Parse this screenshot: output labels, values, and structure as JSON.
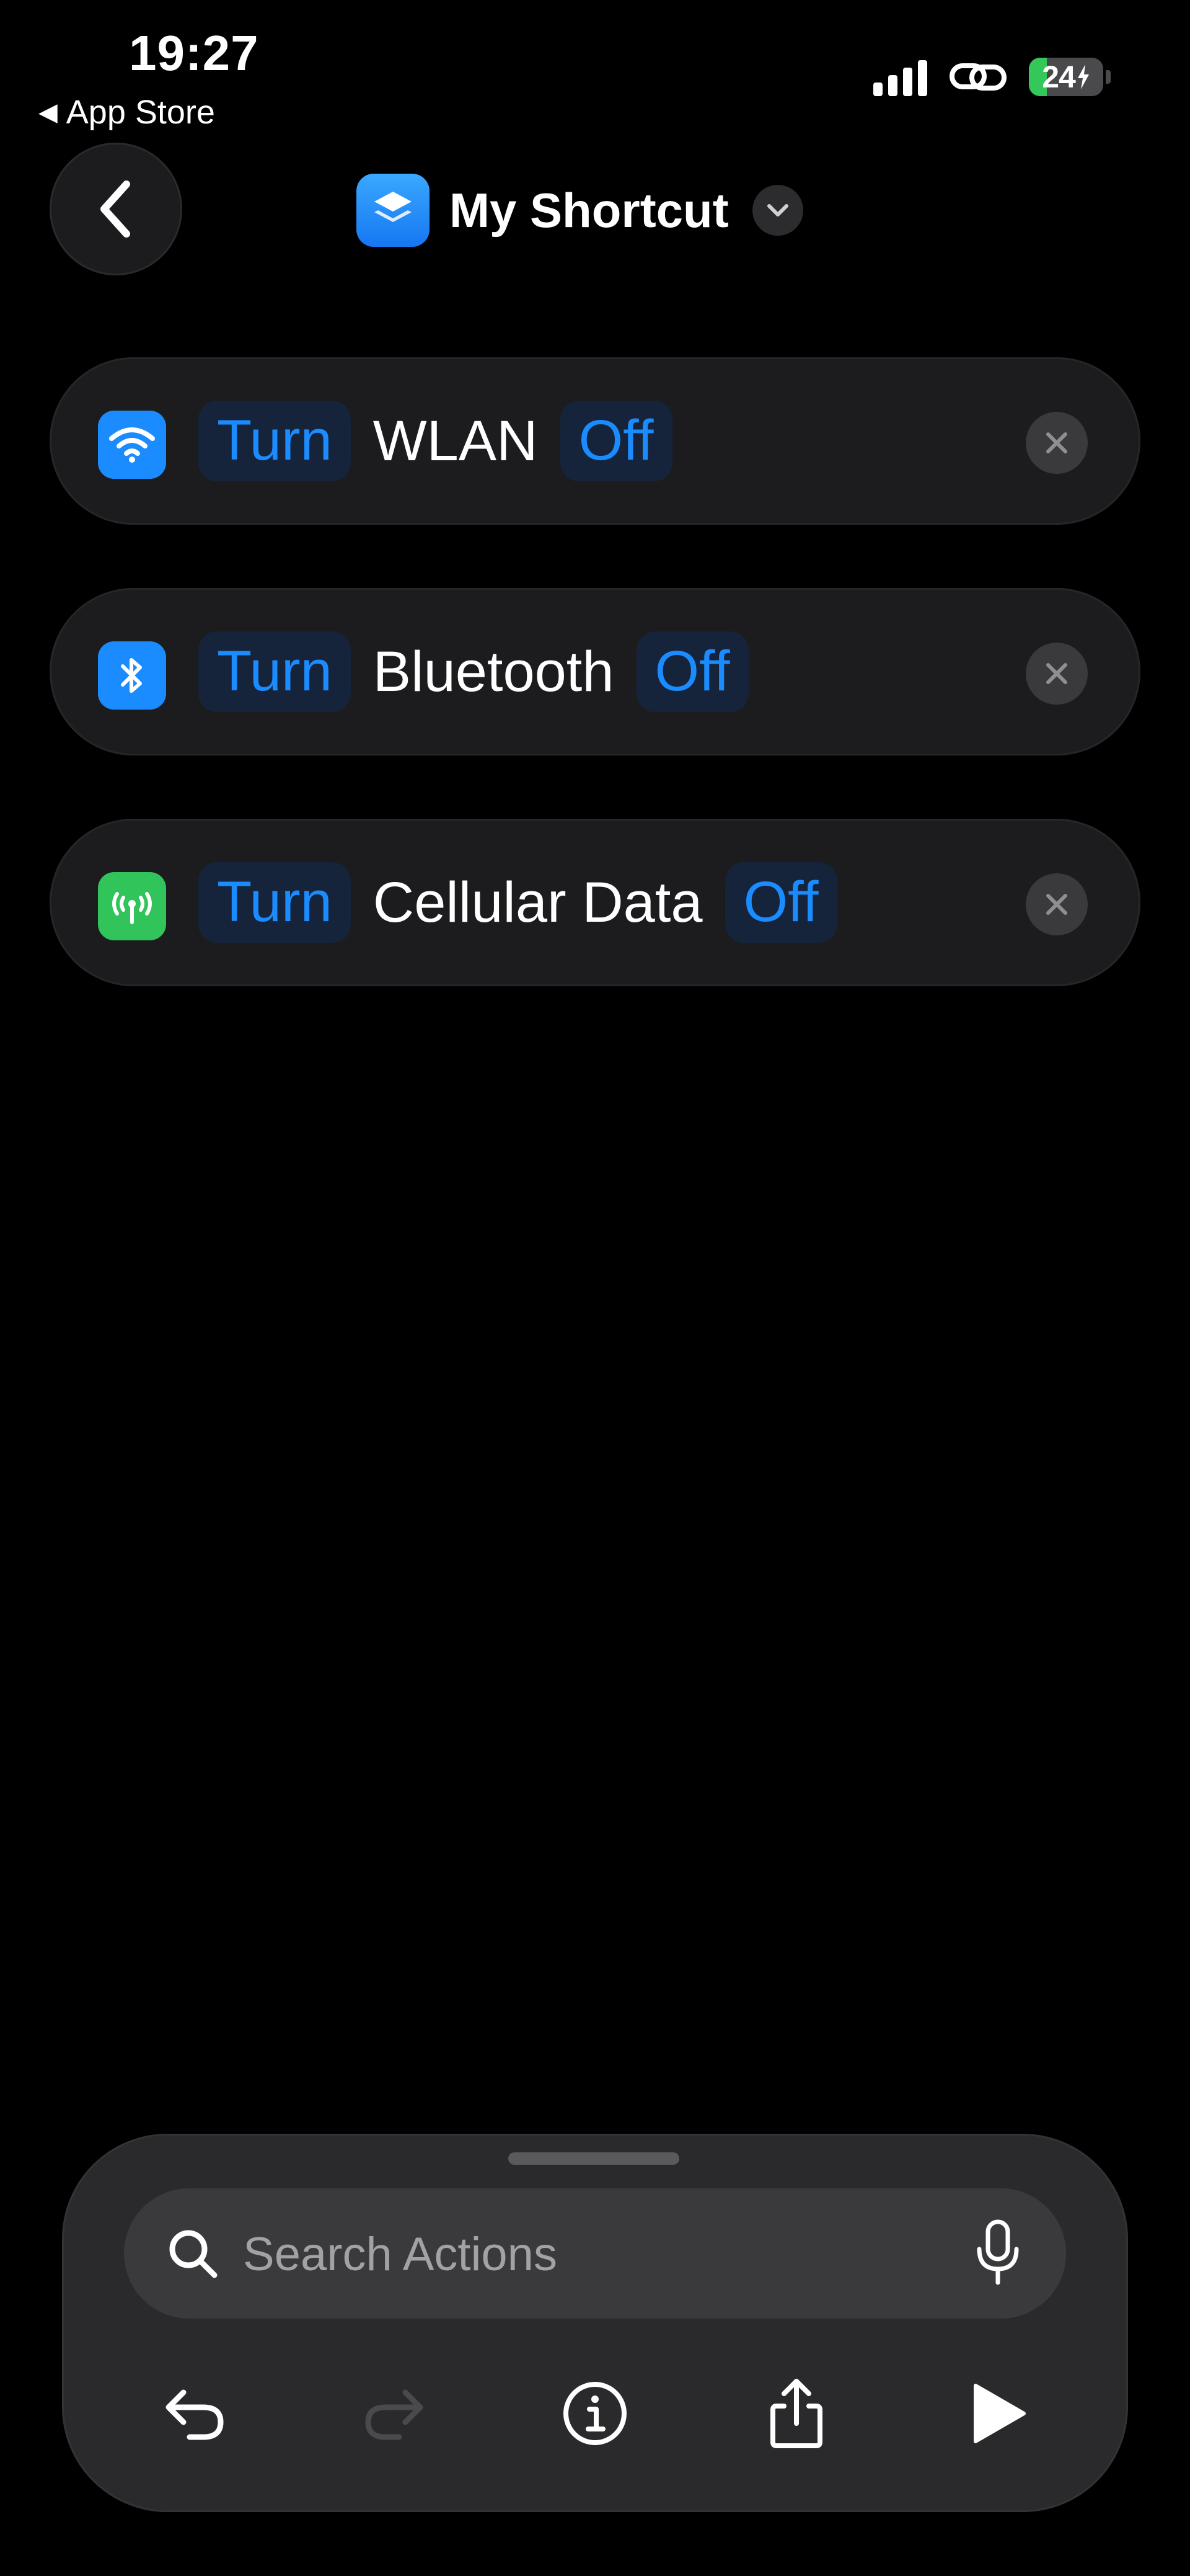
{
  "status_bar": {
    "time": "19:27",
    "back_app": "App Store",
    "battery_level": "24",
    "battery_fill_fraction": 0.24
  },
  "nav": {
    "title": "My Shortcut",
    "icon": "shortcuts-stack-icon"
  },
  "actions": [
    {
      "icon": "wifi-icon",
      "icon_color": "#1a8cff",
      "verb": "Turn",
      "label": "WLAN",
      "state": "Off"
    },
    {
      "icon": "bluetooth-icon",
      "icon_color": "#1a8cff",
      "verb": "Turn",
      "label": "Bluetooth",
      "state": "Off"
    },
    {
      "icon": "cellular-antenna-icon",
      "icon_color": "#30c45a",
      "verb": "Turn",
      "label": "Cellular Data",
      "state": "Off"
    }
  ],
  "search": {
    "placeholder": "Search Actions"
  },
  "toolbar": {
    "items": [
      "undo-icon",
      "redo-icon",
      "info-icon",
      "share-icon",
      "play-icon"
    ]
  },
  "colors": {
    "accent": "#1b8cff",
    "background": "#000000",
    "row_background": "#1c1c1e",
    "panel_background": "#2a2a2c"
  }
}
